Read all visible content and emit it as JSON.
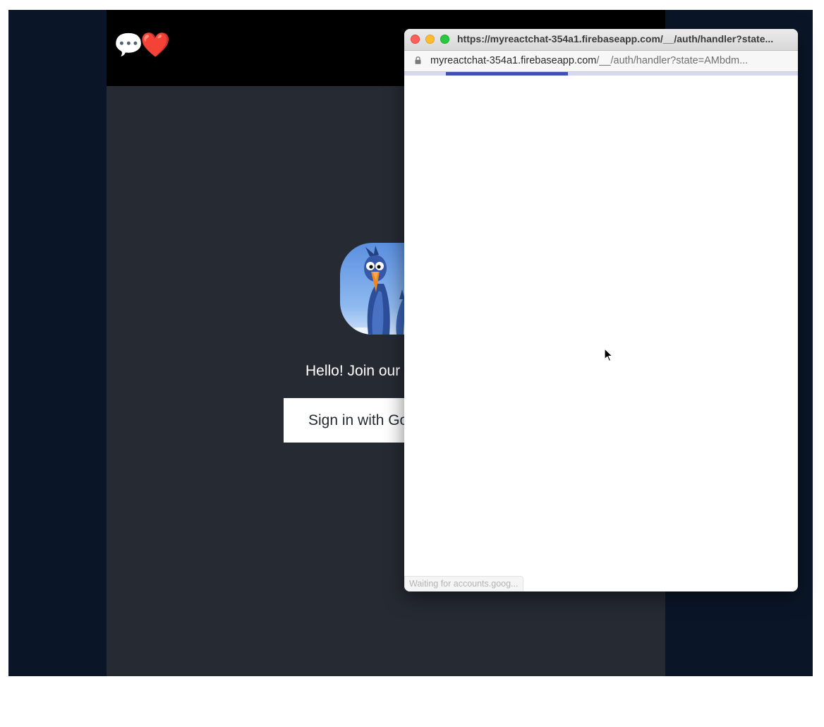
{
  "app": {
    "logo_emojis": "💬❤️😆",
    "welcome_text": "Hello! Join our",
    "signin_label": "Sign in with Go"
  },
  "popup": {
    "window_title": "https://myreactchat-354a1.firebaseapp.com/__/auth/handler?state...",
    "address_domain": "myreactchat-354a1.firebaseapp.com",
    "address_path": "/__/auth/handler?state=AMbdm...",
    "status_text": "Waiting for accounts.goog...",
    "progress_fraction": 0.31
  },
  "colors": {
    "page_bg": "#0a1628",
    "app_bg": "#262a33",
    "header_bg": "#000000",
    "progress": "#3f51b5"
  },
  "icons": {
    "lock": "lock-icon",
    "cursor": "mouse-cursor-icon",
    "hero": "bird-mascot-image"
  }
}
